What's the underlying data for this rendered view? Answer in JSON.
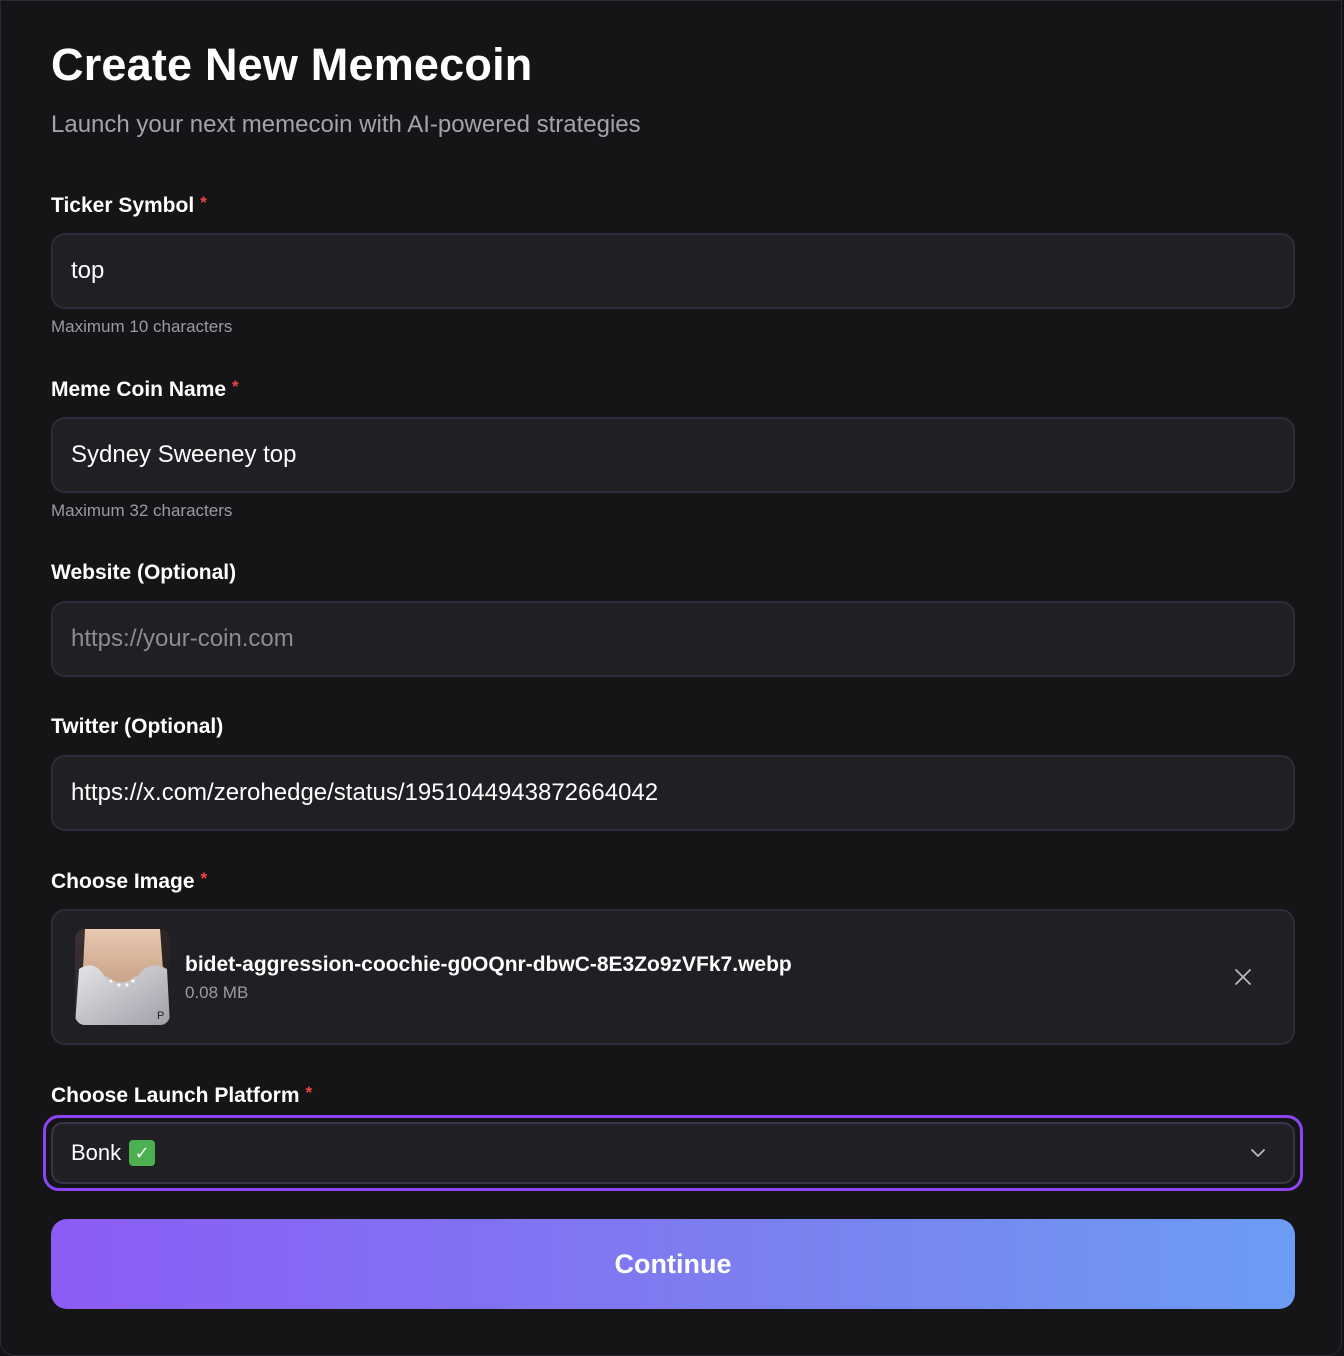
{
  "header": {
    "title": "Create New Memecoin",
    "subtitle": "Launch your next memecoin with AI-powered strategies"
  },
  "fields": {
    "ticker": {
      "label": "Ticker Symbol",
      "required_mark": "*",
      "value": "top",
      "hint": "Maximum 10 characters"
    },
    "name": {
      "label": "Meme Coin Name",
      "required_mark": "*",
      "value": "Sydney Sweeney top",
      "hint": "Maximum 32 characters"
    },
    "website": {
      "label": "Website (Optional)",
      "value": "",
      "placeholder": "https://your-coin.com"
    },
    "twitter": {
      "label": "Twitter (Optional)",
      "value": "https://x.com/zerohedge/status/1951044943872664042"
    },
    "image": {
      "label": "Choose Image",
      "required_mark": "*",
      "file_name": "bidet-aggression-coochie-g0OQnr-dbwC-8E3Zo9zVFk7.webp",
      "file_size": "0.08 MB",
      "remove_icon": "close-icon"
    },
    "platform": {
      "label": "Choose Launch Platform",
      "required_mark": "*",
      "selected": "Bonk",
      "selected_emoji": "✓",
      "dropdown_icon": "chevron-down-icon"
    }
  },
  "actions": {
    "continue_label": "Continue"
  },
  "colors": {
    "background": "#151518",
    "input_bg": "#202024",
    "required": "#ef4444",
    "focus_ring": "#8b45f5",
    "button_gradient_start": "#8b5cf6",
    "button_gradient_end": "#6c9cf4"
  }
}
